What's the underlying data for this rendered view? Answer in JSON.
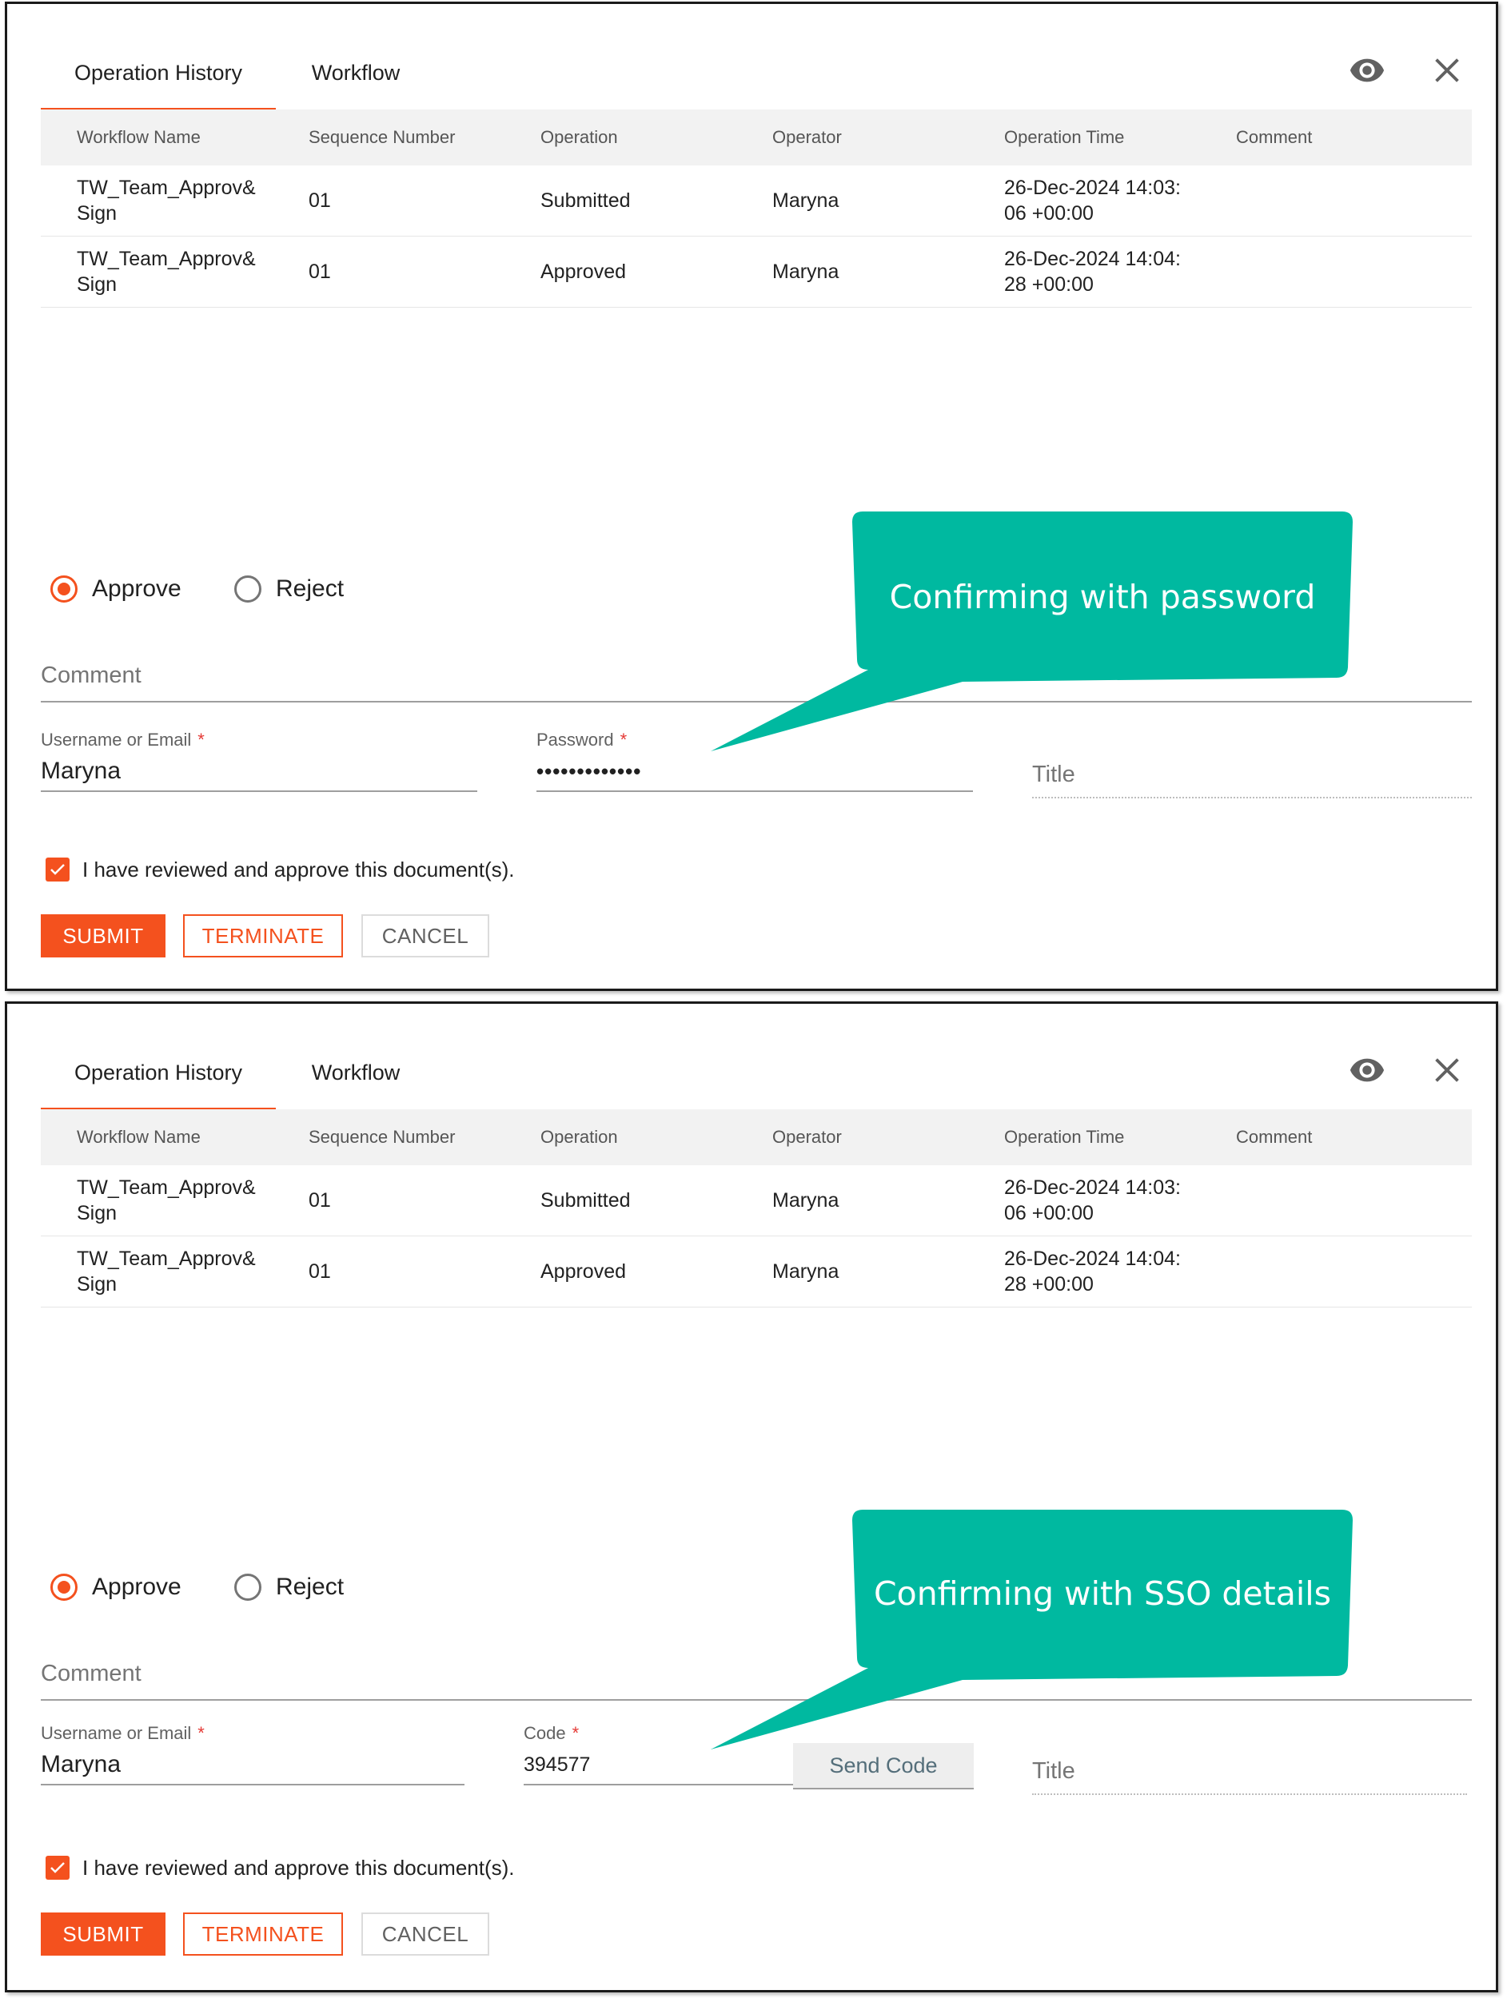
{
  "panels": [
    {
      "tabs": [
        "Operation History",
        "Workflow"
      ],
      "table": {
        "headers": [
          "Workflow Name",
          "Sequence Number",
          "Operation",
          "Operator",
          "Operation Time",
          "Comment"
        ],
        "rows": [
          [
            "TW_Team_Approv&Sign",
            "01",
            "Submitted",
            "Maryna",
            "26-Dec-2024 14:03:06 +00:00",
            ""
          ],
          [
            "TW_Team_Approv&Sign",
            "01",
            "Approved",
            "Maryna",
            "26-Dec-2024 14:04:28 +00:00",
            ""
          ]
        ]
      },
      "radios": [
        "Approve",
        "Reject"
      ],
      "comment_placeholder": "Comment",
      "username_label": "Username or Email",
      "username_value": "Maryna",
      "secret_label": "Password",
      "secret_value": "•••••••••••••",
      "title_placeholder": "Title",
      "confirm_text": "I have reviewed and approve this document(s).",
      "buttons": [
        "SUBMIT",
        "TERMINATE",
        "CANCEL"
      ],
      "callout": "Confirming with password"
    },
    {
      "tabs": [
        "Operation History",
        "Workflow"
      ],
      "table": {
        "headers": [
          "Workflow Name",
          "Sequence Number",
          "Operation",
          "Operator",
          "Operation Time",
          "Comment"
        ],
        "rows": [
          [
            "TW_Team_Approv&Sign",
            "01",
            "Submitted",
            "Maryna",
            "26-Dec-2024 14:03:06 +00:00",
            ""
          ],
          [
            "TW_Team_Approv&Sign",
            "01",
            "Approved",
            "Maryna",
            "26-Dec-2024 14:04:28 +00:00",
            ""
          ]
        ]
      },
      "radios": [
        "Approve",
        "Reject"
      ],
      "comment_placeholder": "Comment",
      "username_label": "Username or Email",
      "username_value": "Maryna",
      "secret_label": "Code",
      "secret_value": "394577",
      "send_code_label": "Send Code",
      "title_placeholder": "Title",
      "confirm_text": "I have reviewed and approve this document(s).",
      "buttons": [
        "SUBMIT",
        "TERMINATE",
        "CANCEL"
      ],
      "callout": "Confirming with SSO details"
    }
  ],
  "colors": {
    "accent": "#f4511e",
    "callout": "#00b9a0"
  }
}
